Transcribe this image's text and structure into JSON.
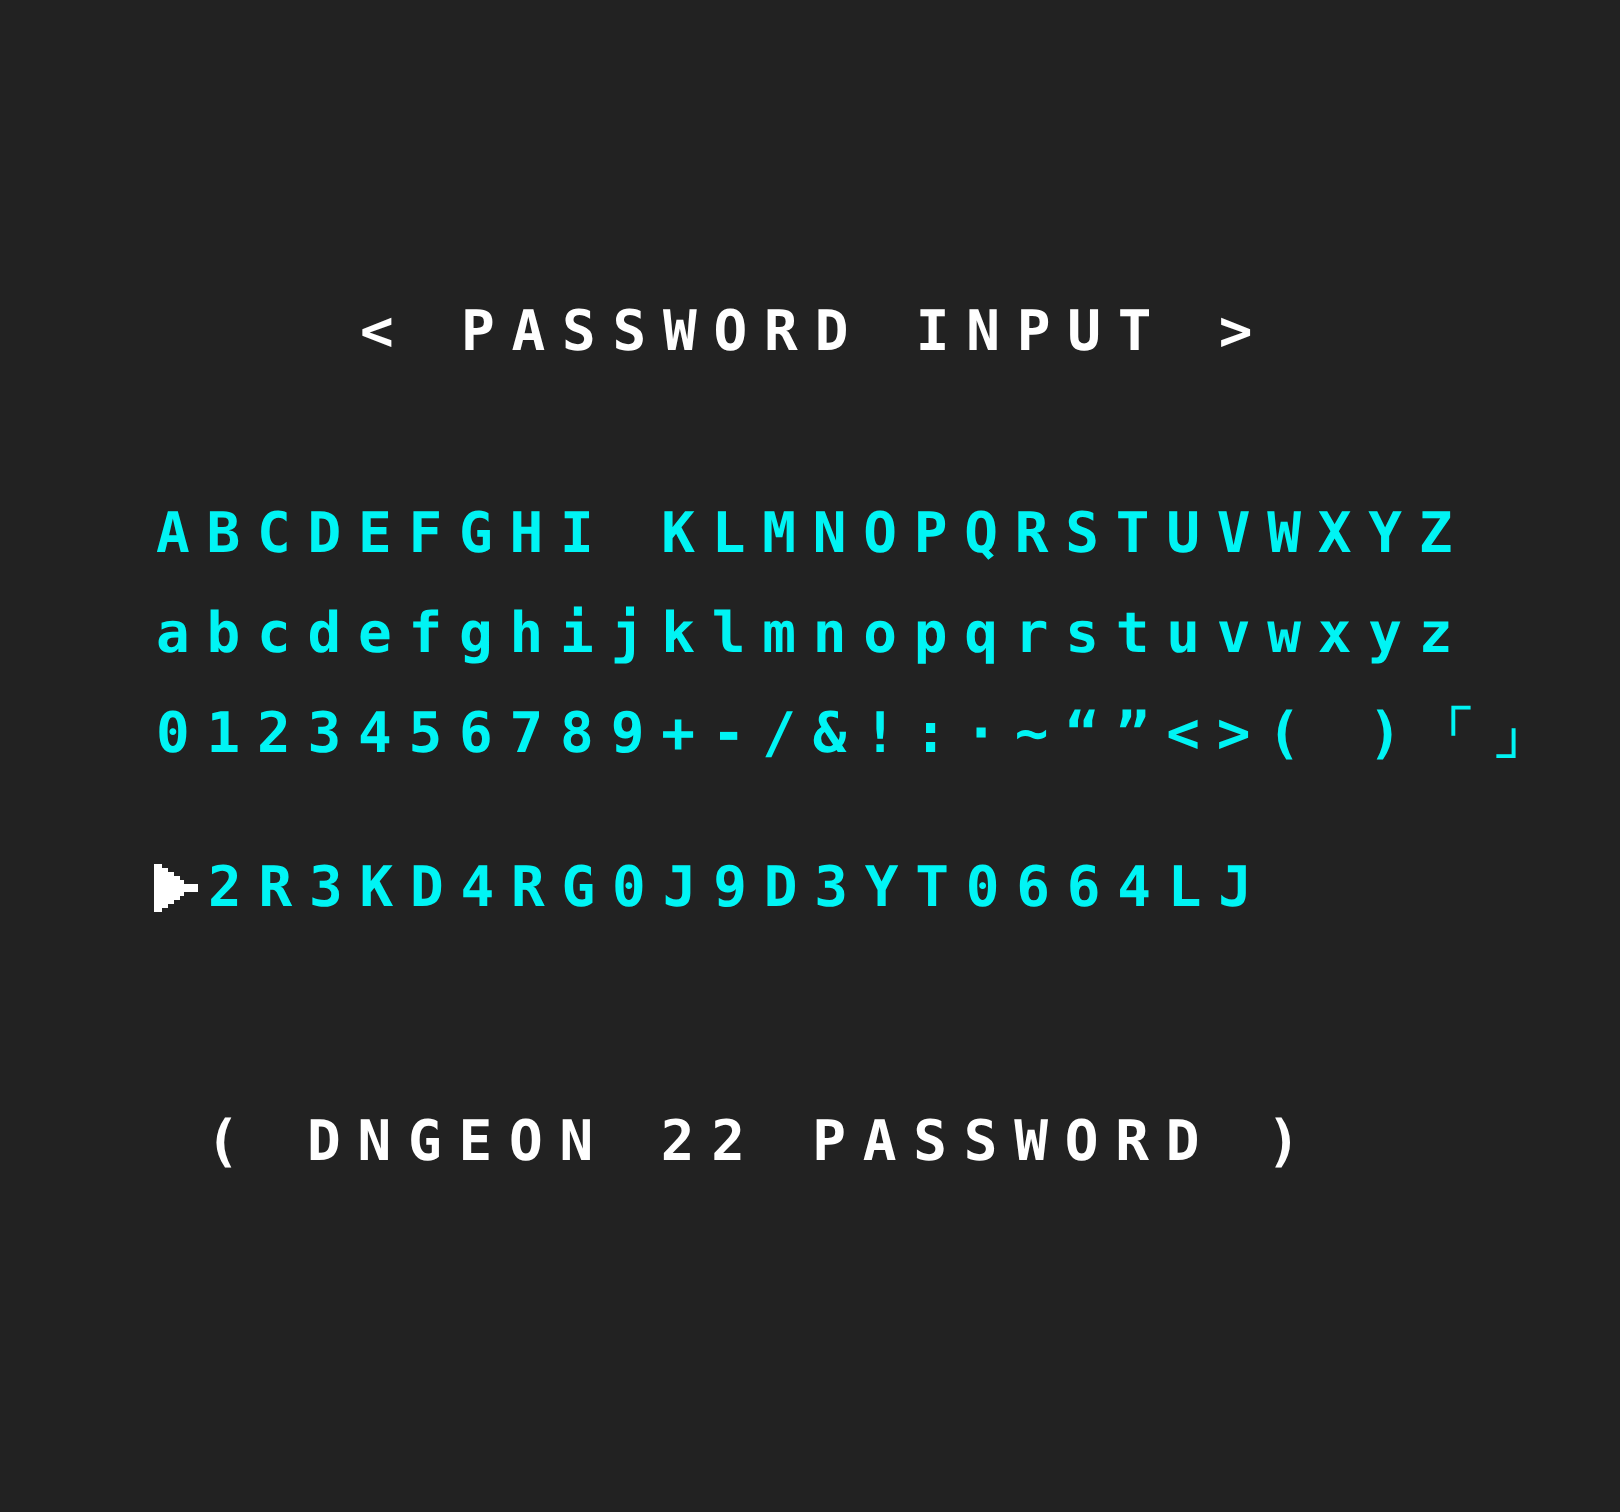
{
  "header": {
    "text": "< PASSWORD INPUT >"
  },
  "character_grid": {
    "rows": [
      "ABCDEFGHI KLMNOPQRSTUVWXYZ",
      "abcdefghijklmnopqrstuvwxyz",
      "0123456789+-/&!:·~“”<>( )「」"
    ]
  },
  "password_entry": {
    "value": "2R3KD4RG0J9D3YT0664LJ"
  },
  "footer": {
    "text": "( DNGEON 22 PASSWORD )"
  }
}
